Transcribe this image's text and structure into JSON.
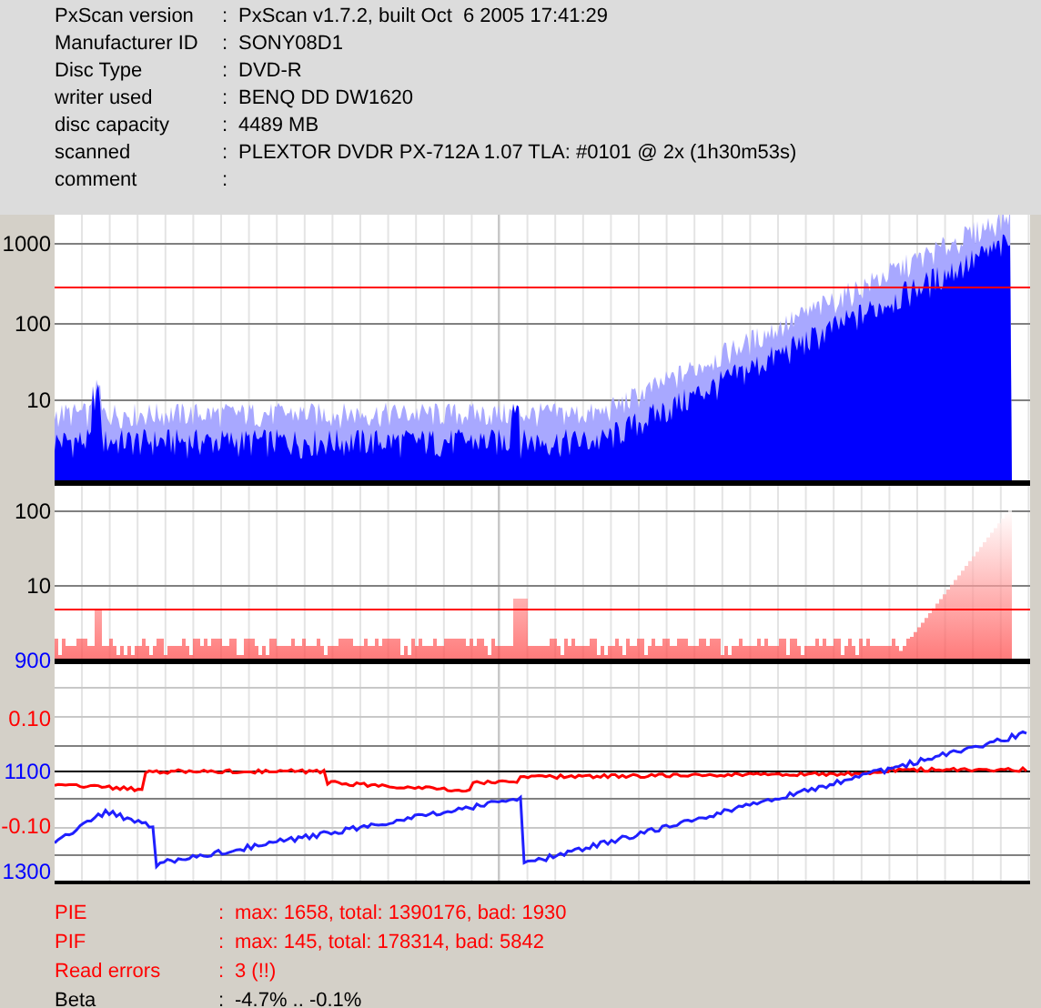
{
  "info": [
    {
      "label": "PxScan version",
      "sep": ":",
      "value": "PxScan v1.7.2, built Oct  6 2005 17:41:29"
    },
    {
      "label": "Manufacturer ID",
      "sep": ":",
      "value": "SONY08D1"
    },
    {
      "label": "Disc Type",
      "sep": ":",
      "value": "DVD-R"
    },
    {
      "label": "writer used",
      "sep": ":",
      "value": "BENQ DD DW1620"
    },
    {
      "label": "disc capacity",
      "sep": ":",
      "value": "4489 MB"
    },
    {
      "label": "scanned",
      "sep": ":",
      "value": "PLEXTOR DVDR PX-712A 1.07 TLA: #0101 @ 2x (1h30m53s)"
    },
    {
      "label": "comment",
      "sep": ":"
    }
  ],
  "panels": [
    {
      "ticks": [
        {
          "label": "1000",
          "color": "#000000"
        },
        {
          "label": "100",
          "color": "#000000"
        },
        {
          "label": "10",
          "color": "#000000"
        }
      ]
    },
    {
      "ticks": [
        {
          "label": "100",
          "color": "#000000"
        },
        {
          "label": "10",
          "color": "#000000"
        },
        {
          "label": "900",
          "color": "#0000ff"
        }
      ]
    },
    {
      "ticks": [
        {
          "label": "0.10",
          "color": "#ff0000"
        },
        {
          "label": "1100",
          "color": "#0000ff"
        },
        {
          "label": "-0.10",
          "color": "#ff0000"
        },
        {
          "label": "1300",
          "color": "#0000ff"
        }
      ]
    }
  ],
  "summary": [
    {
      "label": "PIE",
      "sep": ":",
      "value": "max: 1658, total: 1390176, bad: 1930",
      "color": "#ff0000"
    },
    {
      "label": "PIF",
      "sep": ":",
      "value": "max: 145, total: 178314, bad: 5842",
      "color": "#ff0000"
    },
    {
      "label": "Read errors",
      "sep": ":",
      "value": "3 (!!)",
      "color": "#ff0000"
    },
    {
      "label": "Beta",
      "sep": ":",
      "value": "-4.7% .. -0.1%",
      "color": "#000000"
    }
  ]
}
